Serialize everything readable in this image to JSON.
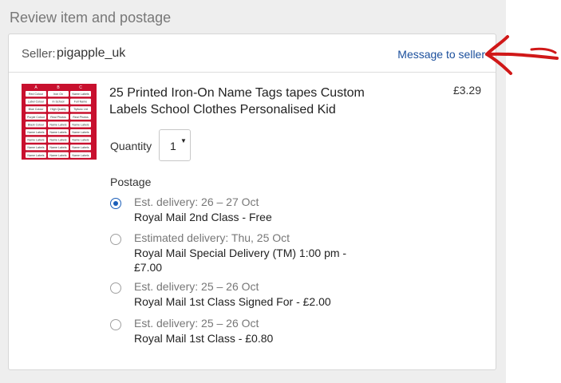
{
  "section": {
    "title": "Review item and postage"
  },
  "seller": {
    "label": "Seller:",
    "name": "pigapple_uk",
    "message_link": "Message to seller"
  },
  "item": {
    "title": "25 Printed Iron-On Name Tags tapes Custom Labels School Clothes Personalised Kid",
    "price": "£3.29",
    "quantity_label": "Quantity",
    "quantity_value": "1"
  },
  "postage": {
    "label": "Postage",
    "options": [
      {
        "estimate": "Est. delivery: 26 – 27 Oct",
        "name": "Royal Mail 2nd Class - Free",
        "selected": true
      },
      {
        "estimate": "Estimated delivery: Thu, 25 Oct",
        "name": "Royal Mail Special Delivery (TM) 1:00 pm - £7.00",
        "selected": false
      },
      {
        "estimate": "Est. delivery: 25 – 26 Oct",
        "name": "Royal Mail 1st Class Signed For - £2.00",
        "selected": false
      },
      {
        "estimate": "Est. delivery: 25 – 26 Oct",
        "name": "Royal Mail 1st Class - £0.80",
        "selected": false
      }
    ]
  },
  "thumbnail": {
    "columns": [
      "A",
      "B",
      "C"
    ],
    "labels": [
      [
        "Red Colour",
        "Iron On",
        "Name Labels"
      ],
      [
        "Label Colour",
        "In School",
        "Full Name"
      ],
      [
        "Blue Colour",
        "High Quality",
        "Tipfunc Ltd"
      ],
      [
        "Purple Colour",
        "Real Photos",
        "Real Photos"
      ],
      [
        "Black Colour",
        "Name Labels",
        "Name Labels"
      ],
      [
        "Name Labels",
        "Name Labels",
        "Name Labels"
      ],
      [
        "Name Labels",
        "Name Labels",
        "Name Labels"
      ],
      [
        "Name Labels",
        "Name Labels",
        "Name Labels"
      ],
      [
        "Name Labels",
        "Name Labels",
        "Name Labels"
      ]
    ]
  },
  "colors": {
    "link": "#1b4f9c",
    "radio_selected": "#1b5eb8",
    "arrow": "#d01818",
    "thumb_bg": "#c8102e"
  }
}
